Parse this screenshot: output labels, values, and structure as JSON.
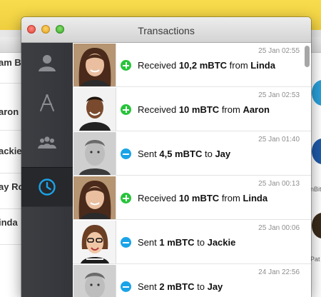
{
  "window": {
    "title": "Transactions"
  },
  "sidebar": {
    "items": [
      {
        "name": "contacts",
        "icon": "person-icon",
        "active": false
      },
      {
        "name": "apps",
        "icon": "compass-a-icon",
        "active": false
      },
      {
        "name": "groups",
        "icon": "group-icon",
        "active": false
      },
      {
        "name": "history",
        "icon": "clock-icon",
        "active": true
      }
    ]
  },
  "transactions": [
    {
      "time": "25 Jan 02:55",
      "direction": "in",
      "verb": "Received",
      "amount": "10,2 mBTC",
      "preposition": "from",
      "name": "Linda"
    },
    {
      "time": "25 Jan 02:53",
      "direction": "in",
      "verb": "Received",
      "amount": "10 mBTC",
      "preposition": "from",
      "name": "Aaron"
    },
    {
      "time": "25 Jan 01:40",
      "direction": "out",
      "verb": "Sent",
      "amount": "4,5 mBTC",
      "preposition": "to",
      "name": "Jay"
    },
    {
      "time": "25 Jan 00:13",
      "direction": "in",
      "verb": "Received",
      "amount": "10 mBTC",
      "preposition": "from",
      "name": "Linda"
    },
    {
      "time": "25 Jan 00:06",
      "direction": "out",
      "verb": "Sent",
      "amount": "1 mBTC",
      "preposition": "to",
      "name": "Jackie"
    },
    {
      "time": "24 Jan 22:56",
      "direction": "out",
      "verb": "Sent",
      "amount": "2 mBTC",
      "preposition": "to",
      "name": "Jay"
    }
  ],
  "background_left": {
    "fragments": [
      "am B",
      "aron",
      "ackie",
      "ay Ro",
      "inda"
    ]
  },
  "background_right": {
    "fragments": [
      "nBit",
      "Pat"
    ]
  },
  "colors": {
    "received": "#27c43a",
    "sent": "#1ba3e8",
    "sidebar": "#3a3c40",
    "accent": "#1ba3e8"
  }
}
